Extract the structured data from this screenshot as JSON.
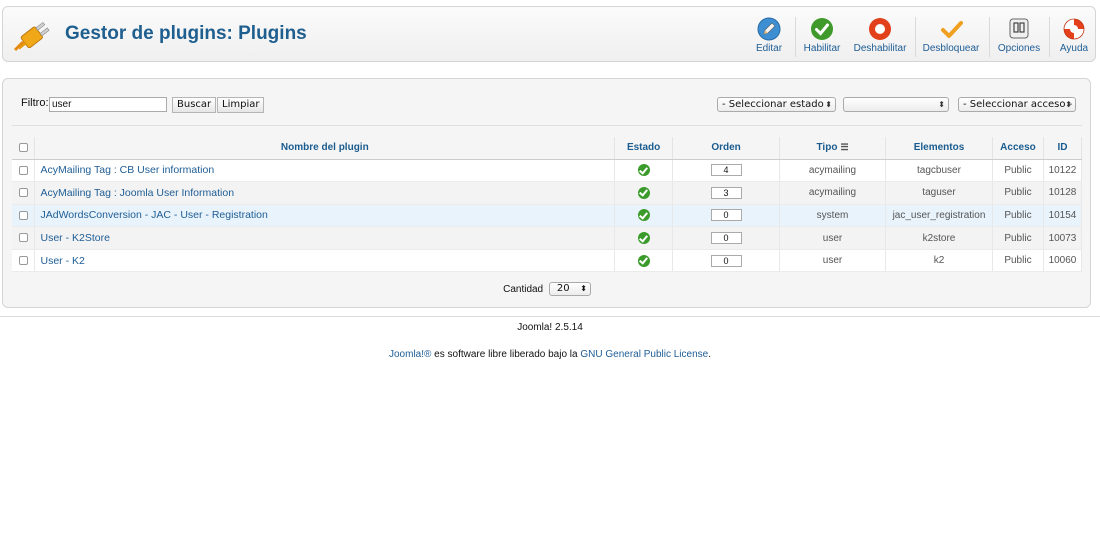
{
  "header": {
    "title": "Gestor de plugins: Plugins",
    "toolbar": [
      {
        "id": "edit",
        "label": "Editar",
        "icon": "pencil-icon"
      },
      {
        "id": "enable",
        "label": "Habilitar",
        "icon": "check-circle-icon"
      },
      {
        "id": "disable",
        "label": "Deshabilitar",
        "icon": "ring-icon"
      },
      {
        "id": "unlock",
        "label": "Desbloquear",
        "icon": "checkmark-icon"
      },
      {
        "id": "options",
        "label": "Opciones",
        "icon": "options-icon"
      },
      {
        "id": "help",
        "label": "Ayuda",
        "icon": "lifebuoy-icon"
      }
    ]
  },
  "filter": {
    "label": "Filtro:",
    "value": "user",
    "search_label": "Buscar",
    "clear_label": "Limpiar",
    "state_select": "- Seleccionar estado -",
    "type_select": "",
    "access_select": "- Seleccionar acceso -"
  },
  "table": {
    "headers": {
      "name": "Nombre del plugin",
      "state": "Estado",
      "order": "Orden",
      "type": "Tipo",
      "elements": "Elementos",
      "access": "Acceso",
      "id": "ID"
    },
    "rows": [
      {
        "name": "AcyMailing Tag : CB User information",
        "order": "4",
        "type": "acymailing",
        "element": "tagcbuser",
        "access": "Public",
        "id": "10122"
      },
      {
        "name": "AcyMailing Tag : Joomla User Information",
        "order": "3",
        "type": "acymailing",
        "element": "taguser",
        "access": "Public",
        "id": "10128"
      },
      {
        "name": "JAdWordsConversion - JAC - User - Registration",
        "order": "0",
        "type": "system",
        "element": "jac_user_registration",
        "access": "Public",
        "id": "10154"
      },
      {
        "name": "User - K2Store",
        "order": "0",
        "type": "user",
        "element": "k2store",
        "access": "Public",
        "id": "10073"
      },
      {
        "name": "User - K2",
        "order": "0",
        "type": "user",
        "element": "k2",
        "access": "Public",
        "id": "10060"
      }
    ]
  },
  "pagination": {
    "label": "Cantidad",
    "value": "20"
  },
  "footer": {
    "version": "Joomla! 2.5.14",
    "license_link1": "Joomla!®",
    "license_text": " es software libre liberado bajo la ",
    "license_link2": "GNU General Public License",
    "license_end": "."
  },
  "colors": {
    "title": "#1f5f8f",
    "link": "#1e5d95",
    "enabled": "#3a9b2a"
  }
}
